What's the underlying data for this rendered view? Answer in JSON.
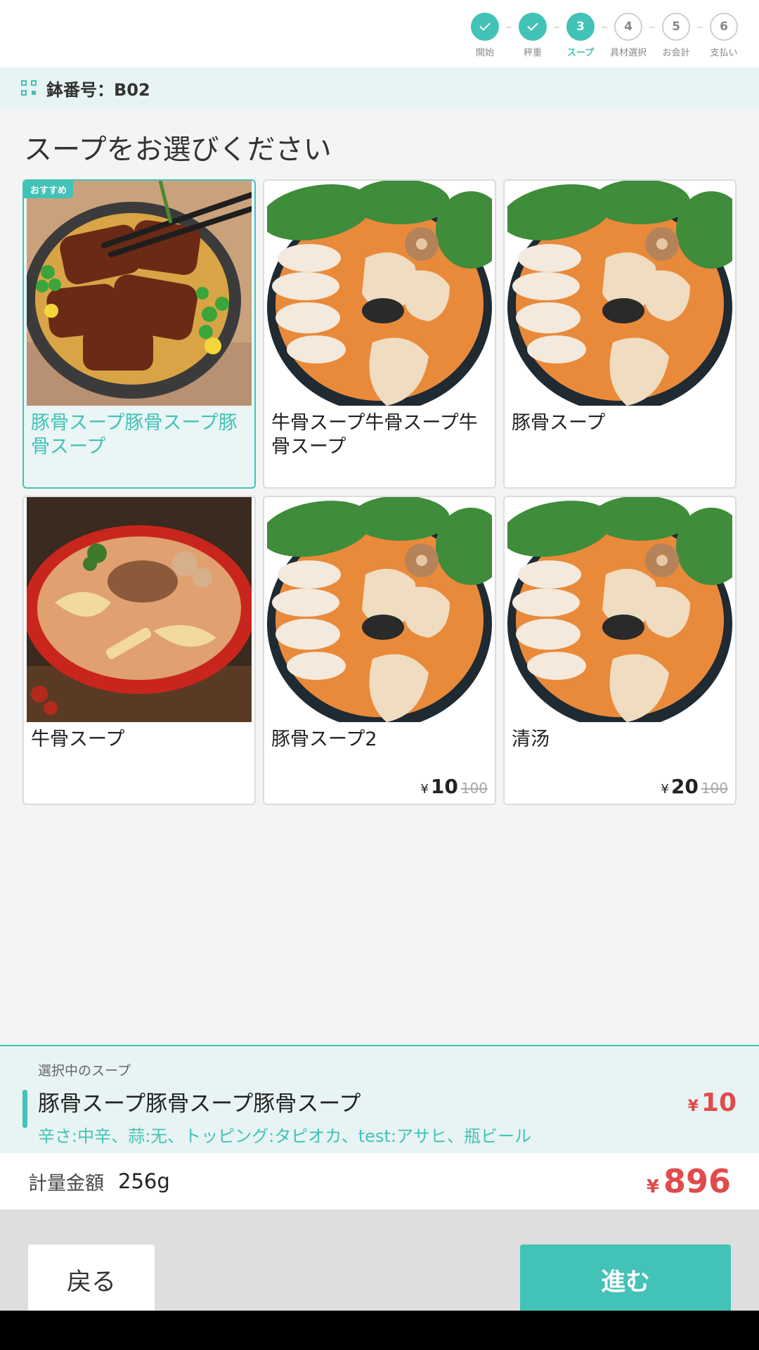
{
  "steps": [
    {
      "num": "",
      "label": "開始",
      "state": "done"
    },
    {
      "num": "",
      "label": "秤重",
      "state": "done"
    },
    {
      "num": "3",
      "label": "スープ",
      "state": "active"
    },
    {
      "num": "4",
      "label": "具材選択",
      "state": "todo"
    },
    {
      "num": "5",
      "label": "お会計",
      "state": "todo"
    },
    {
      "num": "6",
      "label": "支払い",
      "state": "todo"
    }
  ],
  "bowl": {
    "label": "鉢番号：B02"
  },
  "page": {
    "title": "スープをお選びください"
  },
  "soups": [
    {
      "name": "豚骨スープ豚骨スープ豚骨スープ",
      "badge": "おすすめ",
      "selected": true,
      "image": "eel-rice-bowl"
    },
    {
      "name": "牛骨スープ牛骨スープ牛骨スープ",
      "image": "hotpot-soup"
    },
    {
      "name": "豚骨スープ",
      "image": "hotpot-soup"
    },
    {
      "name": "牛骨スープ",
      "image": "spicy-noodle-soup"
    },
    {
      "name": "豚骨スープ2",
      "price": {
        "yen": "¥",
        "now": "10",
        "old": "100"
      },
      "image": "hotpot-soup"
    },
    {
      "name": "清汤",
      "price": {
        "yen": "¥",
        "now": "20",
        "old": "100"
      },
      "image": "hotpot-soup"
    }
  ],
  "selected": {
    "caption": "選択中のスープ",
    "name": "豚骨スープ豚骨スープ豚骨スープ",
    "yen": "¥",
    "price": "10",
    "options": "辛さ:中辛、蒜:无、トッピング:タピオカ、test:アサヒ、瓶ビール"
  },
  "weight": {
    "label": "計量金額",
    "value": "256g",
    "yen": "¥",
    "total": "896"
  },
  "actions": {
    "back": "戻る",
    "next": "進む"
  },
  "colors": {
    "accent": "#43c2b7",
    "price": "#e04b4b"
  }
}
